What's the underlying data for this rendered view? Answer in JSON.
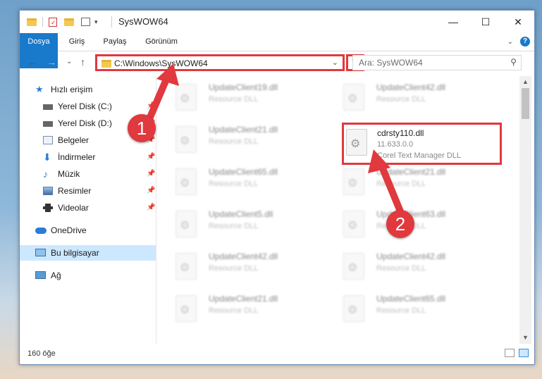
{
  "window": {
    "title": "SysWOW64",
    "minimize": "—",
    "maximize": "☐",
    "close": "✕"
  },
  "ribbon": {
    "tabs": [
      "Dosya",
      "Giriş",
      "Paylaş",
      "Görünüm"
    ],
    "expand": "⌄",
    "help": "?"
  },
  "nav": {
    "back": "←",
    "forward": "→",
    "recent": "⌄",
    "up": "↑",
    "address": "C:\\Windows\\SysWOW64",
    "dropdown": "⌄",
    "refresh": "↻",
    "search_placeholder": "Ara: SysWOW64",
    "search_icon": "⚲"
  },
  "sidebar": {
    "items": [
      {
        "label": "Hızlı erişim",
        "icon": "star-icon"
      },
      {
        "label": "Yerel Disk (C:)",
        "icon": "drive-icon"
      },
      {
        "label": "Yerel Disk (D:)",
        "icon": "drive-icon"
      },
      {
        "label": "Belgeler",
        "icon": "documents-icon"
      },
      {
        "label": "İndirmeler",
        "icon": "download-icon"
      },
      {
        "label": "Müzik",
        "icon": "music-icon"
      },
      {
        "label": "Resimler",
        "icon": "pictures-icon"
      },
      {
        "label": "Videolar",
        "icon": "video-icon"
      },
      {
        "label": "OneDrive",
        "icon": "cloud-icon"
      },
      {
        "label": "Bu bilgisayar",
        "icon": "computer-icon"
      },
      {
        "label": "Ağ",
        "icon": "network-icon"
      }
    ],
    "pin": "📌"
  },
  "files": {
    "left": [
      {
        "name": "UpdateClient19.dll",
        "desc": "Resource DLL"
      },
      {
        "name": "UpdateClient21.dll",
        "desc": "Resource DLL"
      },
      {
        "name": "UpdateClient65.dll",
        "desc": "Resource DLL"
      },
      {
        "name": "UpdateClient5.dll",
        "desc": "Resource DLL"
      },
      {
        "name": "UpdateClient42.dll",
        "desc": "Resource DLL"
      },
      {
        "name": "UpdateClient21.dll",
        "desc": "Resource DLL"
      }
    ],
    "right": [
      {
        "name": "UpdateClient42.dll",
        "desc": "Resource DLL"
      },
      {
        "name": "UpdateClient21.dll",
        "desc": "Resource DLL"
      },
      {
        "name": "UpdateClient63.dll",
        "desc": "Resource DLL"
      },
      {
        "name": "UpdateClient42.dll",
        "desc": "Resource DLL"
      },
      {
        "name": "UpdateClient65.dll",
        "desc": "Resource DLL"
      }
    ],
    "highlighted": {
      "name": "cdrsty110.dll",
      "version": "11.633.0.0",
      "desc": "Corel Text Manager DLL"
    }
  },
  "scroll": {
    "up": "▲",
    "down": "▼"
  },
  "status": {
    "count": "160 öğe"
  },
  "annotations": {
    "step1": "1",
    "step2": "2",
    "color": "#e0393e"
  }
}
